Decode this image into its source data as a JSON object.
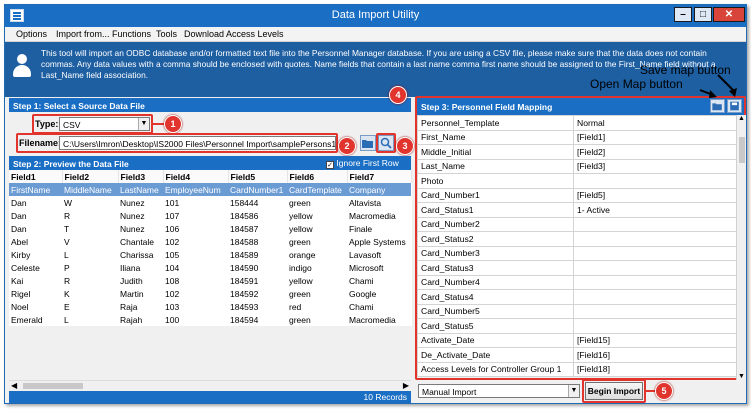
{
  "window": {
    "title": "Data Import Utility",
    "controls": {
      "minimize": "–",
      "maximize": "□",
      "close": "✕"
    }
  },
  "menu": [
    "Options",
    "Import from...",
    "Functions",
    "Tools",
    "Download Access Levels"
  ],
  "banner": {
    "text": "This tool will import an ODBC database and/or formatted text file into the Personnel Manager database.  If you are using a CSV file, please make sure that the data does not contain commas.  Any data values with a comma should be enclosed with quotes.  Name fields that contain a last name comma first name should be assigned to the First_Name field without a Last_Name field association."
  },
  "step1": {
    "title": "Step 1:  Select a Source Data File",
    "type_label": "Type:",
    "type_value": "CSV",
    "filename_label": "Filename:",
    "filename_value": "C:\\Users\\Imron\\Desktop\\IS2000 Files\\Personnel Import\\samplePersons10.csv"
  },
  "step2": {
    "title": "Step 2:  Preview the Data File",
    "ignore_first_row": "Ignore First Row",
    "ignore_checked": true,
    "columns": [
      "Field1",
      "Field2",
      "Field3",
      "Field4",
      "Field5",
      "Field6",
      "Field7"
    ],
    "header_row": [
      "FirstName",
      "MiddleName",
      "LastName",
      "EmployeeNum",
      "CardNumber1",
      "CardTemplate",
      "Company"
    ],
    "rows": [
      [
        "Dan",
        "W",
        "Nunez",
        "101",
        "158444",
        "green",
        "Altavista"
      ],
      [
        "Dan",
        "R",
        "Nunez",
        "107",
        "184586",
        "yellow",
        "Macromedia"
      ],
      [
        "Dan",
        "T",
        "Nunez",
        "106",
        "184587",
        "yellow",
        "Finale"
      ],
      [
        "Abel",
        "V",
        "Chantale",
        "102",
        "184588",
        "green",
        "Apple Systems"
      ],
      [
        "Kirby",
        "L",
        "Charissa",
        "105",
        "184589",
        "orange",
        "Lavasoft"
      ],
      [
        "Celeste",
        "P",
        "Iliana",
        "104",
        "184590",
        "indigo",
        "Microsoft"
      ],
      [
        "Kai",
        "R",
        "Judith",
        "108",
        "184591",
        "yellow",
        "Chami"
      ],
      [
        "Rigel",
        "K",
        "Martin",
        "102",
        "184592",
        "green",
        "Google"
      ],
      [
        "Noel",
        "E",
        "Raja",
        "103",
        "184593",
        "red",
        "Chami"
      ],
      [
        "Emerald",
        "L",
        "Rajah",
        "100",
        "184594",
        "green",
        "Macromedia"
      ]
    ],
    "record_count": "10 Records"
  },
  "step3": {
    "title": "Step 3:  Personnel Field Mapping",
    "mapping": [
      [
        "Personnel_Template",
        "Normal"
      ],
      [
        "First_Name",
        "[Field1]"
      ],
      [
        "Middle_Initial",
        "[Field2]"
      ],
      [
        "Last_Name",
        "[Field3]"
      ],
      [
        "Photo",
        ""
      ],
      [
        "Card_Number1",
        "[Field5]"
      ],
      [
        "Card_Status1",
        "1- Active"
      ],
      [
        "Card_Number2",
        ""
      ],
      [
        "Card_Status2",
        ""
      ],
      [
        "Card_Number3",
        ""
      ],
      [
        "Card_Status3",
        ""
      ],
      [
        "Card_Number4",
        ""
      ],
      [
        "Card_Status4",
        ""
      ],
      [
        "Card_Number5",
        ""
      ],
      [
        "Card_Status5",
        ""
      ],
      [
        "Activate_Date",
        "[Field15]"
      ],
      [
        "De_Activate_Date",
        "[Field16]"
      ],
      [
        "Access Levels for Controller Group 1",
        "[Field18]"
      ]
    ]
  },
  "bottom": {
    "import_mode": "Manual Import",
    "begin_import": "Begin Import"
  },
  "annotations": {
    "save_map": "Save map button",
    "open_map": "Open Map button",
    "badges": [
      "1",
      "2",
      "3",
      "4",
      "5"
    ]
  },
  "colors": {
    "titlebar": "#1a6fc4",
    "banner": "#1e5fa2",
    "header_row": "#6b9bd3",
    "callout": "#e0342c"
  }
}
